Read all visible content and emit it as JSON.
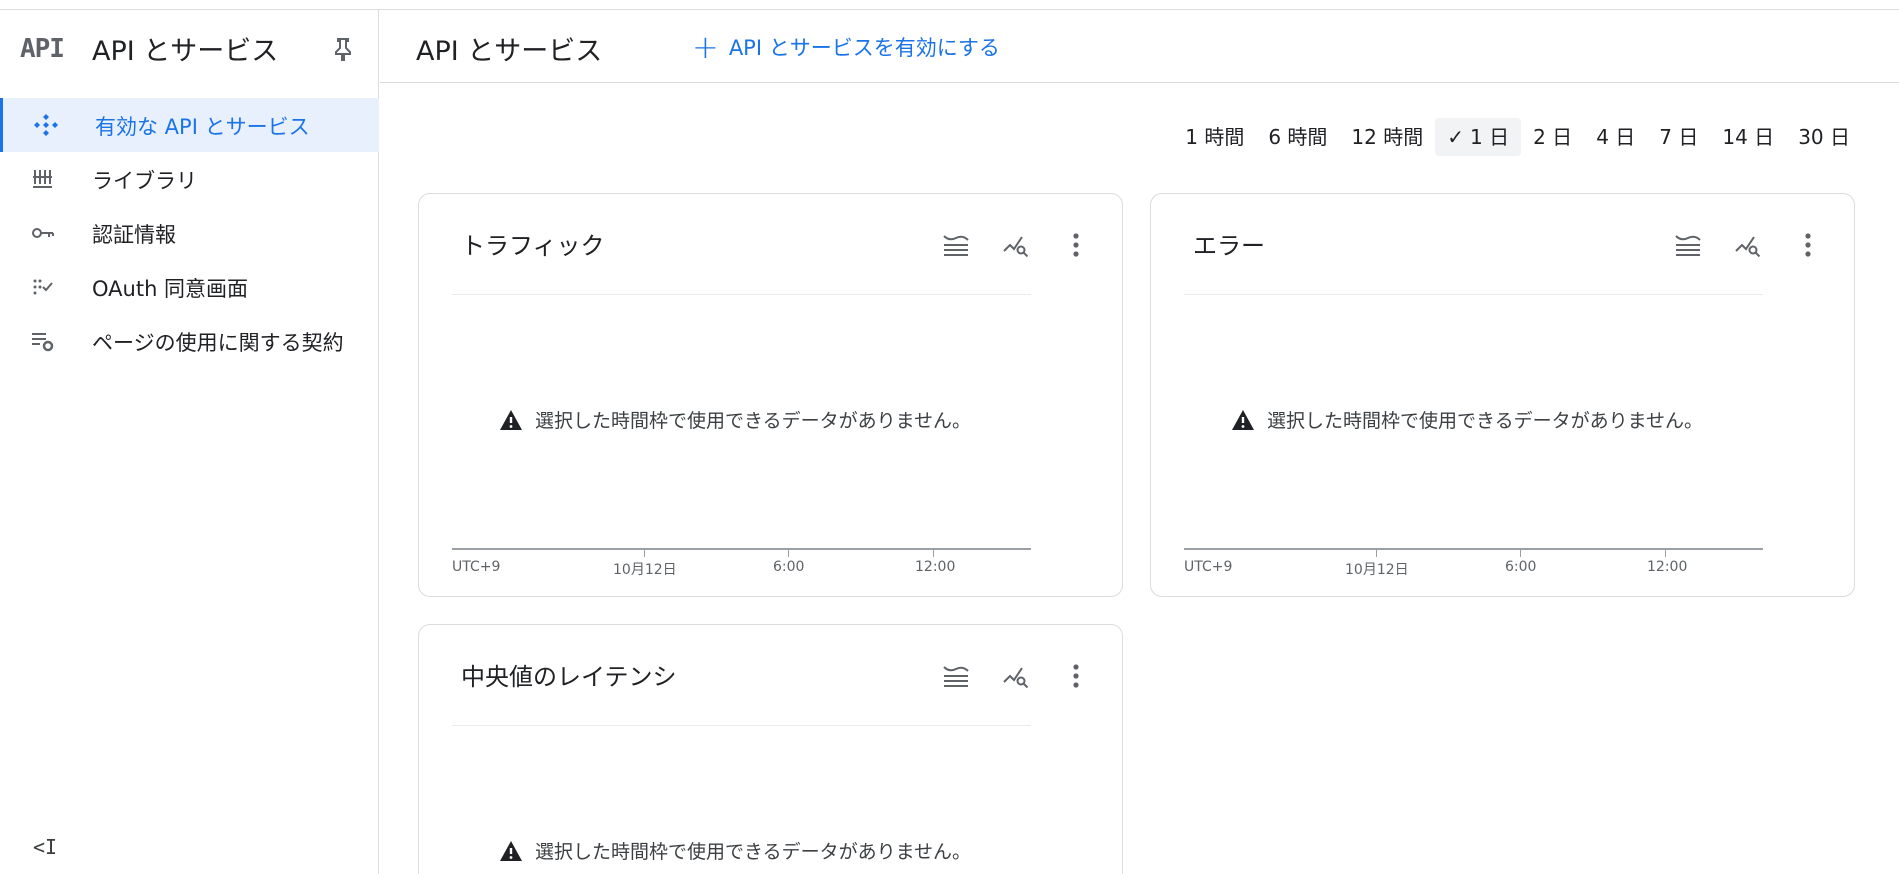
{
  "sidebar": {
    "logo": "API",
    "title": "API とサービス",
    "items": [
      {
        "label": "有効な API とサービス",
        "icon": "api-diamond-icon",
        "active": true
      },
      {
        "label": "ライブラリ",
        "icon": "library-icon",
        "active": false
      },
      {
        "label": "認証情報",
        "icon": "key-icon",
        "active": false
      },
      {
        "label": "OAuth 同意画面",
        "icon": "oauth-consent-icon",
        "active": false
      },
      {
        "label": "ページの使用に関する契約",
        "icon": "page-settings-icon",
        "active": false
      }
    ],
    "collapse_label": "<I"
  },
  "header": {
    "title": "API とサービス",
    "enable_button": "API とサービスを有効にする"
  },
  "time_range": {
    "options": [
      "1 時間",
      "6 時間",
      "12 時間",
      "1 日",
      "2 日",
      "4 日",
      "7 日",
      "14 日",
      "30 日"
    ],
    "selected": "1 日"
  },
  "cards": [
    {
      "title": "トラフィック",
      "no_data": "選択した時間枠で使用できるデータがありません。",
      "axis_labels": [
        "UTC+9",
        "10月12日",
        "6:00",
        "12:00"
      ]
    },
    {
      "title": "エラー",
      "no_data": "選択した時間枠で使用できるデータがありません。",
      "axis_labels": [
        "UTC+9",
        "10月12日",
        "6:00",
        "12:00"
      ]
    },
    {
      "title": "中央値のレイテンシ",
      "no_data": "選択した時間枠で使用できるデータがありません。",
      "axis_labels": []
    }
  ],
  "colors": {
    "accent": "#1a73e8",
    "active_bg": "#e8f0fe",
    "border": "#dadce0",
    "icon_gray": "#5f6368"
  }
}
